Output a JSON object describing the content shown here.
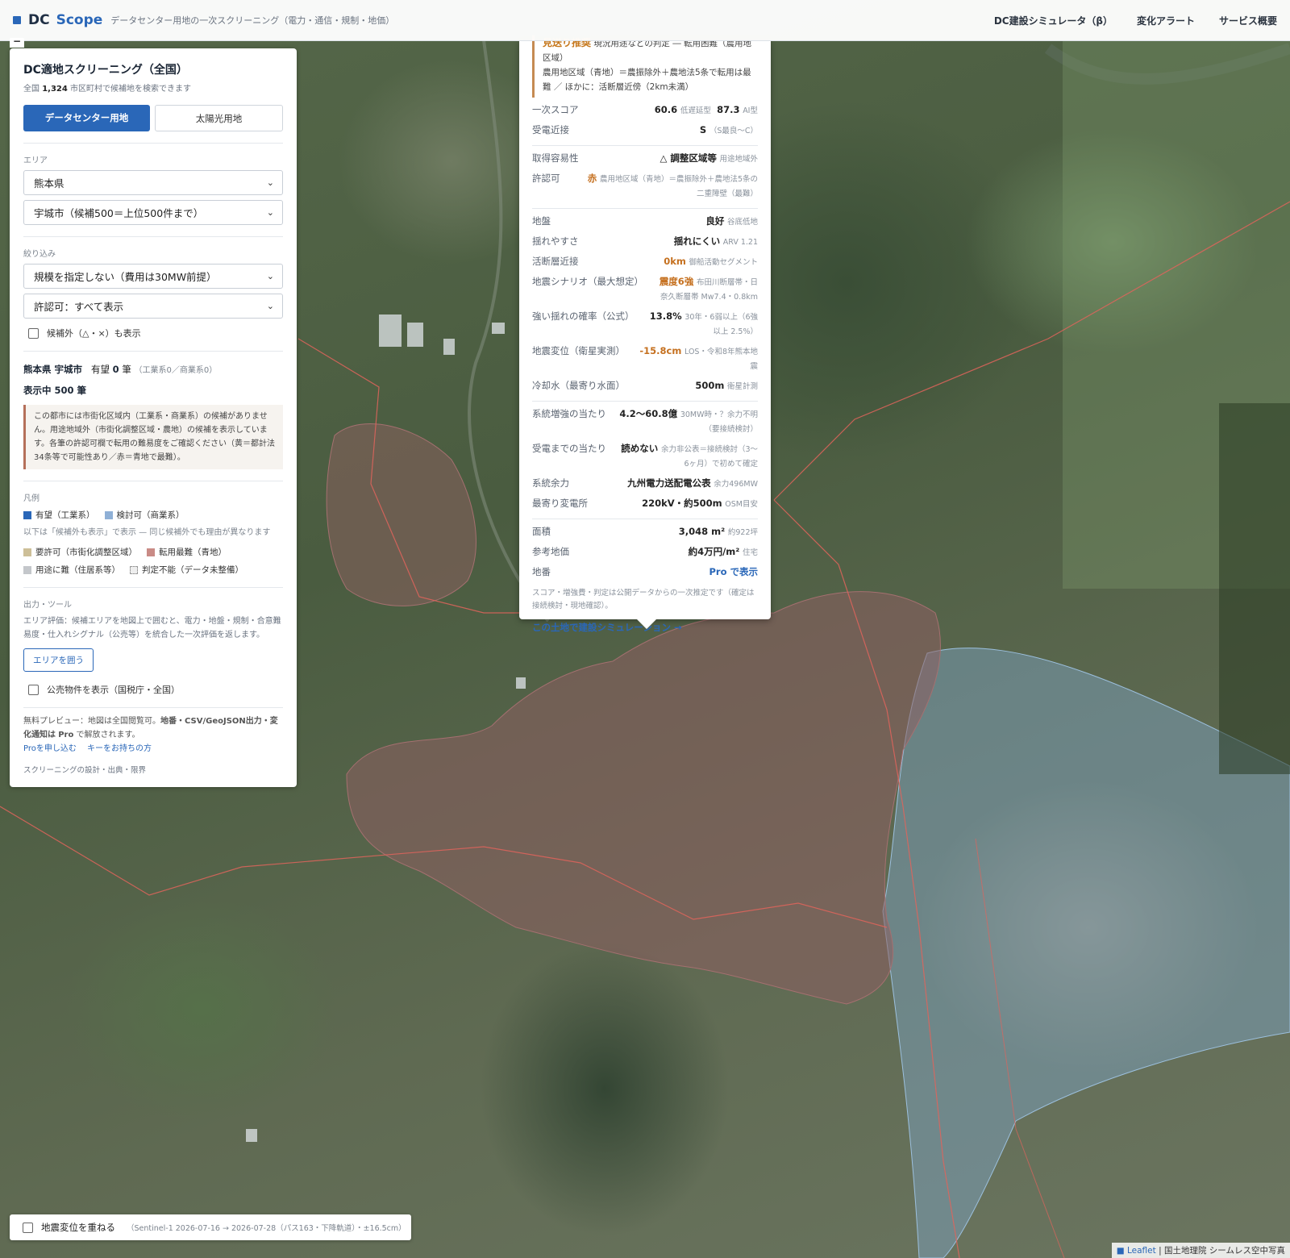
{
  "header": {
    "brand_dc": "DC",
    "brand_scope": "Scope",
    "tagline": "データセンター用地の一次スクリーニング（電力・通信・規制・地価）",
    "nav": [
      "DC建設シミュレータ（β）",
      "変化アラート",
      "サービス概要"
    ]
  },
  "panel": {
    "minimize": "−",
    "title": "DC適地スクリーニング（全国）",
    "sub_prefix": "全国",
    "sub_count": "1,324",
    "sub_suffix": "市区町村で候補地を検索できます",
    "mode_active": "データセンター用地",
    "mode_inactive": "太陽光用地",
    "area_label": "エリア",
    "prefecture": "熊本県",
    "city": "宇城市（候補500＝上位500件まで）",
    "filter_label": "絞り込み",
    "scale": "規模を指定しない（費用は30MW前提）",
    "permit": "許認可：すべて表示",
    "show_excluded": "候補外（△・×）も表示",
    "city_name": "熊本県 宇城市",
    "promising_label": "有望",
    "promising_count": "0",
    "promising_unit": "筆",
    "promising_detail": "（工業系0／商業系0）",
    "showing": "表示中 500 筆",
    "notice": "この都市には市街化区域内（工業系・商業系）の候補がありません。用途地域外（市街化調整区域・農地）の候補を表示しています。各筆の許認可欄で転用の難易度をご確認ください（黄＝都計法34条等で可能性あり／赤＝青地で最難）。",
    "legend_label": "凡例",
    "legend": {
      "industrial": "有望（工業系）",
      "commercial": "検討可（商業系）",
      "note": "以下は「候補外も表示」で表示 — 同じ候補外でも理由が異なります",
      "permit_required": "要許可（市街化調整区域）",
      "conversion_hard": "転用最難（青地）",
      "residential": "用途に難（住居系等）",
      "undetermined": "判定不能（データ未整備）"
    },
    "tools_label": "出力・ツール",
    "tools_desc": "エリア評価：候補エリアを地図上で囲むと、電力・地盤・規制・合意難易度・仕入れシグナル（公売等）を統合した一次評価を返します。",
    "enclose_button": "エリアを囲う",
    "public_sale": "公売物件を表示（国税庁・全国）",
    "pro_text_1": "無料プレビュー：地図は全国閲覧可。",
    "pro_text_bold": "地番・CSV/GeoJSON出力・変化通知は",
    "pro_text_pro": "Pro",
    "pro_text_2": "で解放されます。",
    "pro_apply": "Proを申し込む",
    "pro_key": "キーをお持ちの方",
    "footer": "スクリーニングの設計・出典・限界"
  },
  "popup": {
    "warn_title": "見送り推奨",
    "warn_line1": "現況用途などの判定 ― 転用困難（農用地区域）",
    "warn_line2": "農用地区域（青地）＝農振除外＋農地法5条で転用は最難 ／ ほかに：活断層近傍（2km未満）",
    "score_label": "一次スコア",
    "score_low": "60.6",
    "score_low_tag": "低遅延型",
    "score_ai": "87.3",
    "score_ai_tag": "AI型",
    "substation_label": "受電近接",
    "substation_value": "S",
    "substation_tag": "（S最良〜C）",
    "acquire_label": "取得容易性",
    "acquire_value": "△ 調整区域等",
    "acquire_tag": "用途地域外",
    "permit_label": "許認可",
    "permit_value": "赤",
    "permit_tag": "農用地区域（青地）＝農振除外＋農地法5条の二重障壁（最難）",
    "ground_label": "地盤",
    "ground_value": "良好",
    "ground_tag": "谷底低地",
    "shake_label": "揺れやすさ",
    "shake_value": "揺れにくい",
    "shake_tag": "ARV 1.21",
    "fault_label": "活断層近接",
    "fault_value": "0km",
    "fault_tag": "御船活動セグメント",
    "quake_label": "地震シナリオ（最大想定）",
    "quake_value": "震度6強",
    "quake_tag": "布田川断層帯・日奈久断層帯 Mw7.4・0.8km",
    "prob_label": "強い揺れの確率（公式）",
    "prob_value": "13.8%",
    "prob_tag": "30年・6弱以上（6強以上 2.5%）",
    "deform_label": "地震変位（衛星実測）",
    "deform_value": "-15.8cm",
    "deform_tag": "LOS・令和8年熊本地震",
    "water_label": "冷却水（最寄り水面）",
    "water_value": "500m",
    "water_tag": "衛星計測",
    "grid_label": "系統増強の当たり",
    "grid_value": "4.2〜60.8億",
    "grid_tag": "30MW時・？余力不明（要接続検討）",
    "recv_label": "受電までの当たり",
    "recv_value": "読めない",
    "recv_tag": "余力非公表＝接続検討（3〜6ヶ月）で初めて確定",
    "capacity_label": "系統余力",
    "capacity_value": "九州電力送配電公表",
    "capacity_tag": "余力496MW",
    "nearest_label": "最寄り変電所",
    "nearest_value": "220kV・約500m",
    "nearest_tag": "OSM目安",
    "area_label": "面積",
    "area_value": "3,048 m²",
    "area_tag": "約922坪",
    "price_label": "参考地価",
    "price_value": "約4万円/m²",
    "price_tag": "住宅",
    "lot_label": "地番",
    "lot_value": "Pro で表示",
    "note": "スコア・増強費・判定は公開データからの一次推定です（確定は接続検討・現地確認）。",
    "simulate": "この土地で建設シミュレーション →"
  },
  "bottom": {
    "overlay_label": "地震変位を重ねる",
    "overlay_detail": "（Sentinel-1 2026-07-16 → 2026-07-28（パス163・下降軌道）・±16.5cm）"
  },
  "attribution": {
    "leaflet": "Leaflet",
    "source": "| 国土地理院 シームレス空中写真"
  },
  "colors": {
    "accent": "#2a67b8",
    "industrial": "#2a67b8",
    "commercial": "#8fb0d6",
    "permit_required": "#cdbf98",
    "conversion_hard": "#c98b86",
    "residential": "#c4c7cb",
    "warning": "#c5761a"
  }
}
